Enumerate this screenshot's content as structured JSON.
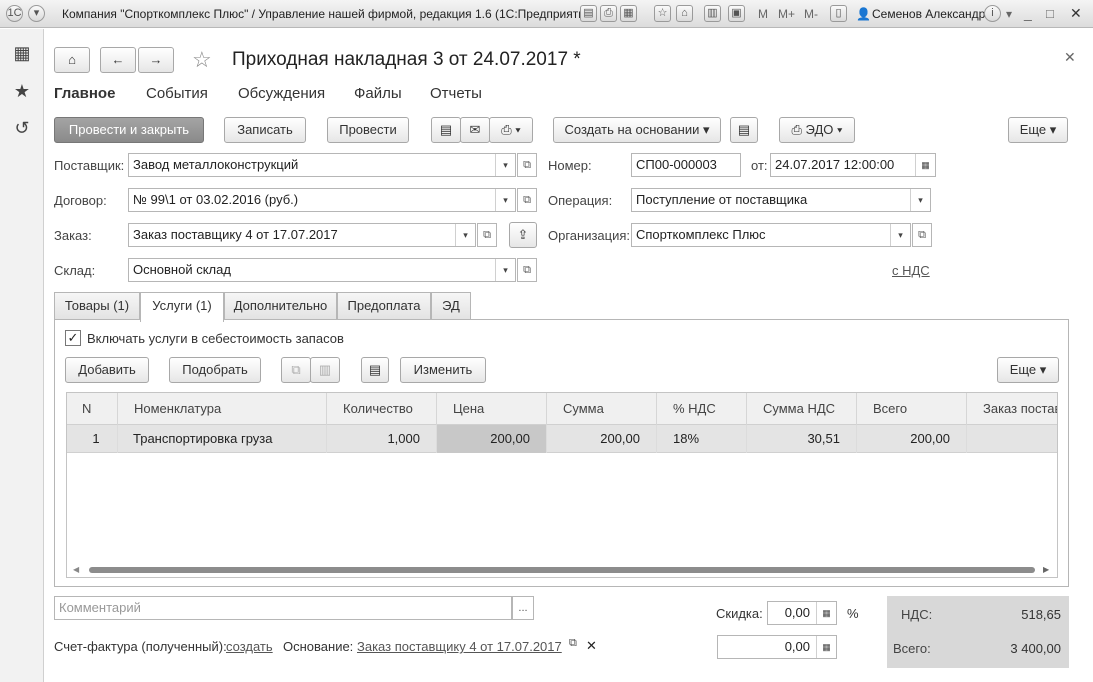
{
  "window": {
    "title": "Компания \"Спорткомплекс Плюс\" / Управление нашей фирмой, редакция 1.6  (1С:Предприятие)",
    "user": "Семенов Александр",
    "memory_buttons": [
      "M",
      "M+",
      "M-"
    ]
  },
  "document": {
    "title": "Приходная накладная 3 от 24.07.2017 *"
  },
  "menu": [
    "Главное",
    "События",
    "Обсуждения",
    "Файлы",
    "Отчеты"
  ],
  "toolbar": {
    "post_close": "Провести и закрыть",
    "save": "Записать",
    "post": "Провести",
    "create_based": "Создать на основании",
    "edo": "ЭДО",
    "more": "Еще"
  },
  "fields": {
    "supplier_label": "Поставщик:",
    "supplier": "Завод металлоконструкций",
    "contract_label": "Договор:",
    "contract": "№ 99\\1 от 03.02.2016 (руб.)",
    "order_label": "Заказ:",
    "order": "Заказ поставщику 4 от 17.07.2017",
    "warehouse_label": "Склад:",
    "warehouse": "Основной склад",
    "number_label": "Номер:",
    "number": "СП00-000003",
    "date_label": "от:",
    "date": "24.07.2017 12:00:00",
    "operation_label": "Операция:",
    "operation": "Поступление от поставщика",
    "organization_label": "Организация:",
    "organization": "Спорткомплекс Плюс",
    "vat_link": "с НДС"
  },
  "tabs": [
    "Товары (1)",
    "Услуги (1)",
    "Дополнительно",
    "Предоплата",
    "ЭД"
  ],
  "services": {
    "include_checkbox": "Включать услуги в себестоимость запасов",
    "add": "Добавить",
    "pick": "Подобрать",
    "change": "Изменить",
    "more": "Еще"
  },
  "table": {
    "columns": [
      "N",
      "Номенклатура",
      "Количество",
      "Цена",
      "Сумма",
      "% НДС",
      "Сумма НДС",
      "Всего",
      "Заказ постав"
    ],
    "rows": [
      [
        "1",
        "Транспортировка груза",
        "1,000",
        "200,00",
        "200,00",
        "18%",
        "30,51",
        "200,00",
        ""
      ]
    ]
  },
  "footer": {
    "comment_placeholder": "Комментарий",
    "comment_btn": "...",
    "invoice_label": "Счет-фактура (полученный):",
    "invoice_link": "создать",
    "basis_label": "Основание:",
    "basis_link": "Заказ поставщику 4 от 17.07.2017",
    "discount_label": "Скидка:",
    "discount_value": "0,00",
    "percent": "%",
    "amount_value": "0,00",
    "vat_total_label": "НДС:",
    "vat_total": "518,65",
    "grand_total_label": "Всего:",
    "grand_total": "3 400,00"
  }
}
